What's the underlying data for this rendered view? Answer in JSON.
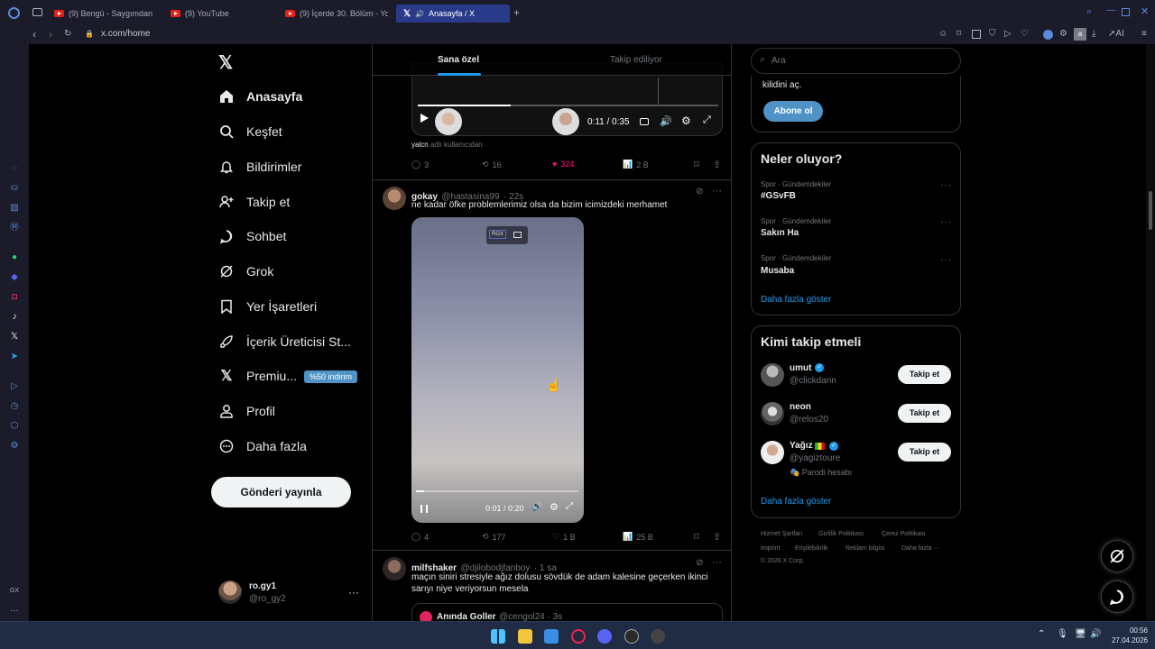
{
  "browser": {
    "tabs": [
      {
        "label": "(9) Bengü - Saygımdan (A"
      },
      {
        "label": "(9) YouTube"
      },
      {
        "label": "(9) İçerde 30. Bölüm - You"
      },
      {
        "label": "Anasayfa / X"
      }
    ],
    "url": "x.com/home",
    "toolbar_ai_label": "AI"
  },
  "nav": {
    "items": [
      {
        "label": "Anasayfa"
      },
      {
        "label": "Keşfet"
      },
      {
        "label": "Bildirimler"
      },
      {
        "label": "Takip et"
      },
      {
        "label": "Sohbet"
      },
      {
        "label": "Grok"
      },
      {
        "label": "Yer İşaretleri"
      },
      {
        "label": "İçerik Üreticisi St..."
      },
      {
        "label": "Premiu..."
      },
      {
        "label": "Profil"
      },
      {
        "label": "Daha fazla"
      }
    ],
    "premium_badge": "%50 indirim",
    "post_button": "Gönderi yayınla",
    "account": {
      "name": "ro.gy1",
      "handle": "@ro_gy2"
    }
  },
  "timeline": {
    "tabs": [
      {
        "label": "Sana özel"
      },
      {
        "label": "Takip ediliyor"
      }
    ],
    "tweet1": {
      "video_time": "0:11 / 0:35",
      "attribution_user": "yalcn",
      "attribution_text": "adlı kullanıcıdan",
      "replies": "3",
      "retweets": "16",
      "likes": "324",
      "views": "2 B"
    },
    "tweet2": {
      "name": "gokay",
      "handle": "@hastasina99",
      "time": "· 22s",
      "text": "ne kadar öfke problemlerimiz olsa da bizim icimizdeki merhamet",
      "video_badge": "RGX",
      "video_time": "0:01 / 0:20",
      "replies": "4",
      "retweets": "177",
      "likes": "1 B",
      "views": "25 B"
    },
    "tweet3": {
      "name": "milfshaker",
      "handle": "@djilobodjfanboy",
      "time": "· 1 sa",
      "text": "maçın siniri stresiyle ağız dolusu sövdük de adam kalesine geçerken ikinci sarıyı niye veriyorsun mesela",
      "quote_name": "Anında Goller",
      "quote_handle": "@cengol24 · 3s"
    }
  },
  "right": {
    "search_placeholder": "Ara",
    "premium_text": "kilidini aç.",
    "subscribe_button": "Abone ol",
    "trends_title": "Neler oluyor?",
    "trends": [
      {
        "category": "Spor · Gündemdekiler",
        "name": "#GSvFB"
      },
      {
        "category": "Spor · Gündemdekiler",
        "name": "Sakın Ha"
      },
      {
        "category": "Spor · Gündemdekiler",
        "name": "Musaba"
      }
    ],
    "show_more": "Daha fazla göster",
    "who_title": "Kimi takip etmeli",
    "who": [
      {
        "name": "umut",
        "handle": "@clickdann",
        "button": "Takip et"
      },
      {
        "name": "neon",
        "handle": "@relos20",
        "button": "Takip et"
      },
      {
        "name": "Yağız",
        "handle": "@yagiztoure",
        "button": "Takip et",
        "note": "Parodi hesabı"
      }
    ],
    "who_show_more": "Daha fazla göster",
    "footer": {
      "l1": "Hizmet Şartları",
      "l2": "Gizlilik Politikası",
      "l3": "Çerez Politikası",
      "l4": "Imprint",
      "l5": "Erişilebilirlik",
      "l6": "Reklam bilgisi",
      "l7": "Daha fazla ···",
      "copyright": "© 2026 X Corp."
    }
  },
  "taskbar": {
    "time": "00:56",
    "date": "27.04.2026"
  },
  "colors": {
    "accent": "#1d9bf0",
    "like": "#f91880",
    "subscribe": "#4f93c6"
  }
}
